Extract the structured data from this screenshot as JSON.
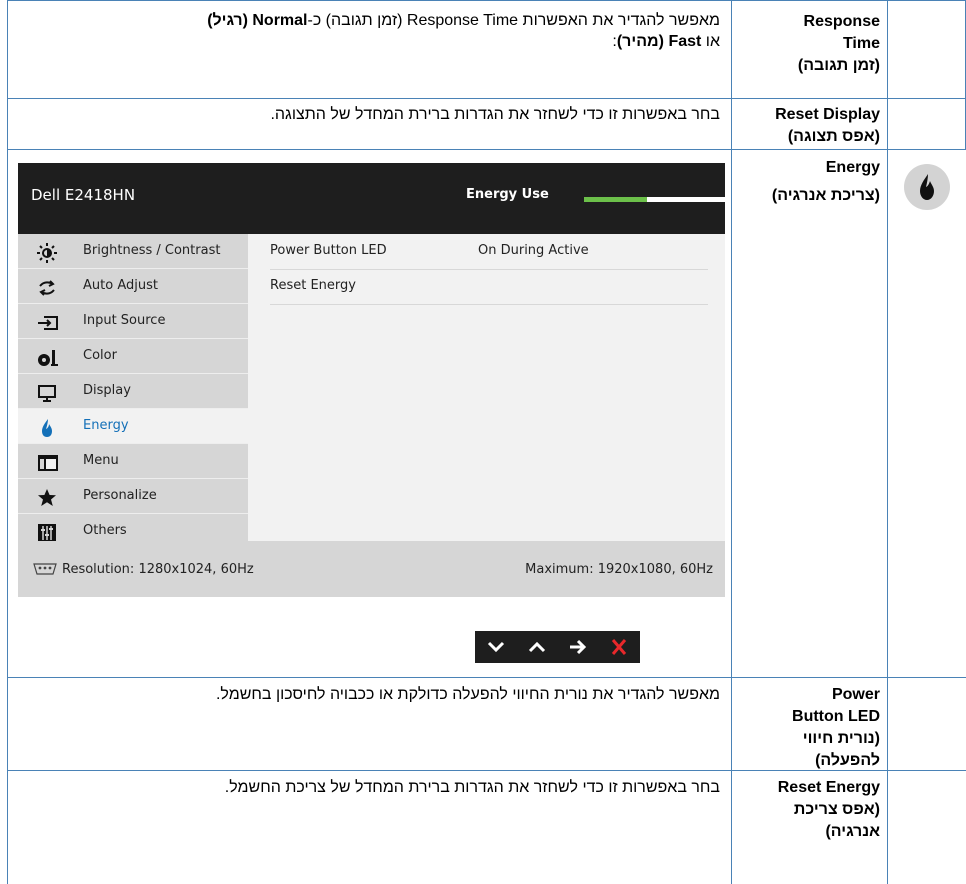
{
  "rows": {
    "response_time": {
      "name_en": "Response Time",
      "name_he": "(זמן תגובה)",
      "desc_line1_parts": [
        "מאפשר להגדיר את האפשרות ",
        "Response Time",
        " (זמן תגובה) כ-",
        "Normal",
        " ",
        "(רגיל)"
      ],
      "desc_line2_parts": [
        "או ",
        "Fast",
        " ",
        "(מהיר)",
        ":"
      ]
    },
    "reset_display": {
      "name_en": "Reset Display",
      "name_he": "(אפס תצוגה)",
      "desc": "בחר באפשרות זו כדי לשחזר את הגדרות ברירת המחדל של התצוגה."
    },
    "energy": {
      "name_en": "Energy",
      "name_he": "(צריכת אנרגיה)"
    },
    "power_button_led": {
      "name_en_l1": "Power",
      "name_en_l2": "Button LED",
      "name_he_l1": "(נורית חיווי",
      "name_he_l2": "להפעלה)",
      "desc": "מאפשר להגדיר את נורית החיווי להפעלה כדולקת או ככבויה לחיסכון בחשמל."
    },
    "reset_energy": {
      "name_en": "Reset Energy",
      "name_he_l1": "(אפס צריכת",
      "name_he_l2": "אנרגיה)",
      "desc": "בחר באפשרות זו כדי לשחזר את הגדרות ברירת המחדל של צריכת החשמל."
    }
  },
  "osd": {
    "model": "Dell E2418HN",
    "energy_use_label": "Energy Use",
    "energy_use_level": 0.45,
    "menu": [
      {
        "label": "Brightness / Contrast",
        "icon": "brightness-icon"
      },
      {
        "label": "Auto Adjust",
        "icon": "auto-adjust-icon"
      },
      {
        "label": "Input Source",
        "icon": "input-source-icon"
      },
      {
        "label": "Color",
        "icon": "color-icon"
      },
      {
        "label": "Display",
        "icon": "display-icon"
      },
      {
        "label": "Energy",
        "icon": "energy-icon",
        "active": true
      },
      {
        "label": "Menu",
        "icon": "menu-icon"
      },
      {
        "label": "Personalize",
        "icon": "star-icon"
      },
      {
        "label": "Others",
        "icon": "others-icon"
      }
    ],
    "submenu": [
      {
        "label": "Power Button LED",
        "value": "On During Active"
      },
      {
        "label": "Reset Energy",
        "value": ""
      }
    ],
    "resolution": "Resolution: 1280x1024, 60Hz",
    "maximum": "Maximum: 1920x1080, 60Hz",
    "nav_buttons": [
      "down-arrow-icon",
      "up-arrow-icon",
      "right-arrow-icon",
      "close-icon"
    ]
  },
  "colors": {
    "border": "#4a82b6",
    "osd_dark": "#1e1e1e",
    "menu_bg": "#d6d6d6",
    "accent_blue": "#1470b8",
    "energy_green": "#6cc04a",
    "close_red": "#e8282b"
  }
}
